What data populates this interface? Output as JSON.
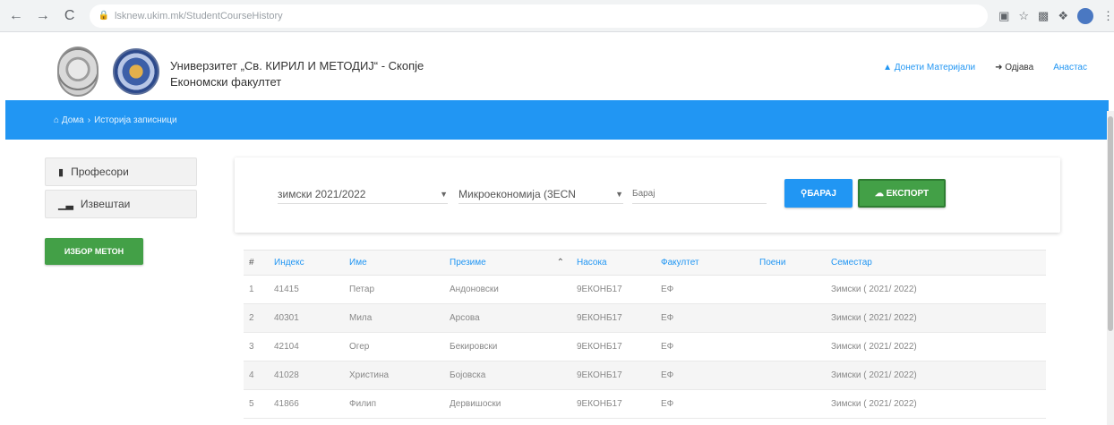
{
  "browser": {
    "url": "lsknew.ukim.mk/StudentCourseHistory",
    "back_icon": "←",
    "forward_icon": "→",
    "reload_icon": "C"
  },
  "header": {
    "university": "Универзитет „Св. КИРИЛ И МЕТОДИЈ“ - Скопје",
    "faculty": "Економски факултет",
    "links": [
      "Донети Материјали",
      "Одјава",
      "Анастас"
    ]
  },
  "breadcrumb": {
    "home": "Дома",
    "current": "Историја записници"
  },
  "sidebar": {
    "items": [
      {
        "label": "Професори",
        "icon": "book-icon"
      },
      {
        "label": "Извештаи",
        "icon": "bar-chart-icon"
      }
    ],
    "green_button": "ИЗБОР МЕТОН"
  },
  "filters": {
    "semester": "зимски 2021/2022",
    "subject": "Микроекономија (3ECN",
    "search_placeholder": "Барај",
    "search_button": "БАРАЈ",
    "export_button": "ЕКСПОРТ"
  },
  "table": {
    "columns": [
      "#",
      "Индекс",
      "Име",
      "Презиме",
      "Насока",
      "Факултет",
      "Поени",
      "Семестар"
    ],
    "rows": [
      [
        "1",
        "41415",
        "Петар",
        "Андоновски",
        "9ЕКОНБ17",
        "ЕФ",
        "",
        "Зимски ( 2021/ 2022)"
      ],
      [
        "2",
        "40301",
        "Мила",
        "Арсова",
        "9ЕКОНБ17",
        "ЕФ",
        "",
        "Зимски ( 2021/ 2022)"
      ],
      [
        "3",
        "42104",
        "Огер",
        "Бекировски",
        "9ЕКОНБ17",
        "ЕФ",
        "",
        "Зимски ( 2021/ 2022)"
      ],
      [
        "4",
        "41028",
        "Христина",
        "Бојовска",
        "9ЕКОНБ17",
        "ЕФ",
        "",
        "Зимски ( 2021/ 2022)"
      ],
      [
        "5",
        "41866",
        "Филип",
        "Дервишоски",
        "9ЕКОНБ17",
        "ЕФ",
        "",
        "Зимски ( 2021/ 2022)"
      ]
    ]
  },
  "colors": {
    "primary": "#2196f3",
    "success": "#43a047"
  }
}
